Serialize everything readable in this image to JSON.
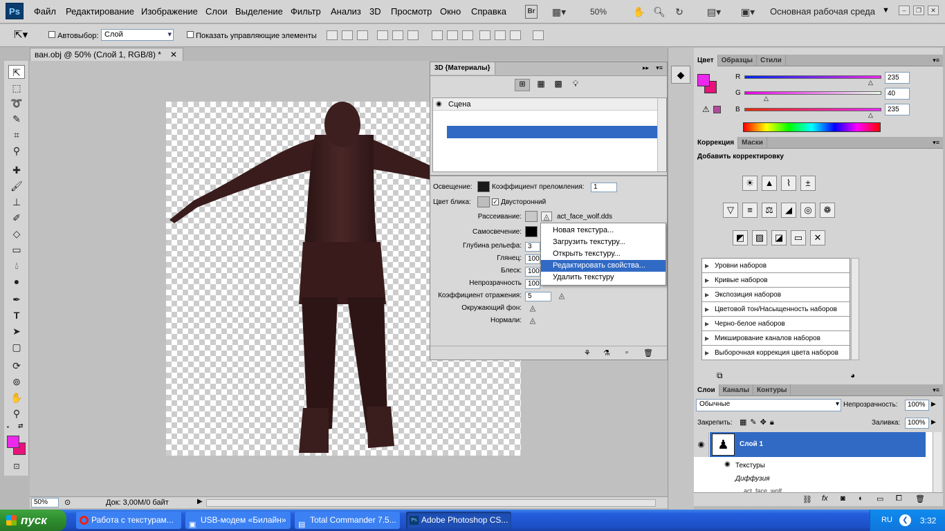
{
  "app": {
    "logo": "Ps",
    "workspace_label": "Основная рабочая среда",
    "zoom": "50%",
    "bridge": "Br"
  },
  "menu": [
    "Файл",
    "Редактирование",
    "Изображение",
    "Слои",
    "Выделение",
    "Фильтр",
    "Анализ",
    "3D",
    "Просмотр",
    "Окно",
    "Справка"
  ],
  "options": {
    "autoselect_label": "Автовыбор:",
    "autoselect_value": "Слой",
    "show_controls_label": "Показать управляющие элементы"
  },
  "document": {
    "tab_title": "ван.obj @ 50% (Слой 1, RGB/8) *",
    "status_zoom": "50%",
    "status_doc": "Док: 3,00M/0 байт"
  },
  "panel3d": {
    "title": "3D {Материалы}",
    "scene_label": "Сцена",
    "props": {
      "lighting": "Освещение:",
      "refraction": "Коэффициент преломления:",
      "refraction_value": "1",
      "specular": "Цвет блика:",
      "two_sided": "Двусторонний",
      "diffuse": "Рассеивание:",
      "diffuse_texture": "act_face_wolf.dds",
      "self_illum": "Самосвечение:",
      "bump": "Глубина рельефа:",
      "bump_value": "3",
      "gloss": "Глянец:",
      "gloss_value": "100",
      "shine": "Блеск:",
      "shine_value": "100",
      "opacity": "Непрозрачность",
      "opacity_value": "100",
      "reflection": "Коэффициент отражения:",
      "reflection_value": "5",
      "environment": "Окружающий фон:",
      "normals": "Нормали:"
    }
  },
  "context_menu": [
    "Новая текстура...",
    "Загрузить текстуру...",
    "Открыть текстуру...",
    "Редактировать свойства...",
    "Удалить текстуру"
  ],
  "color_panel": {
    "tabs": [
      "Цвет",
      "Образцы",
      "Стили"
    ],
    "r_label": "R",
    "g_label": "G",
    "b_label": "B",
    "r": "235",
    "g": "40",
    "b": "235",
    "foreground": "#eb28eb"
  },
  "correction_panel": {
    "tabs": [
      "Коррекция",
      "Маски"
    ],
    "title": "Добавить корректировку",
    "presets": [
      "Уровни наборов",
      "Кривые наборов",
      "Экспозиция наборов",
      "Цветовой тон/Насыщенность наборов",
      "Черно-белое наборов",
      "Микширование каналов наборов",
      "Выборочная коррекция цвета наборов"
    ]
  },
  "layers_panel": {
    "tabs": [
      "Слои",
      "Каналы",
      "Контуры"
    ],
    "blend_mode": "Обычные",
    "opacity_label": "Непрозрачность:",
    "opacity": "100%",
    "lock_label": "Закрепить:",
    "fill_label": "Заливка:",
    "fill": "100%",
    "layer_name": "Слой 1",
    "textures_label": "Текстуры",
    "diffuse_label": "Диффузия",
    "texture_item": "act_face_wolf"
  },
  "taskbar": {
    "start": "пуск",
    "tasks": [
      "Работа с текстурам...",
      "USB-модем «Билайн»",
      "Total Commander 7.5...",
      "Adobe Photoshop CS..."
    ],
    "lang": "RU",
    "time": "3:32"
  }
}
